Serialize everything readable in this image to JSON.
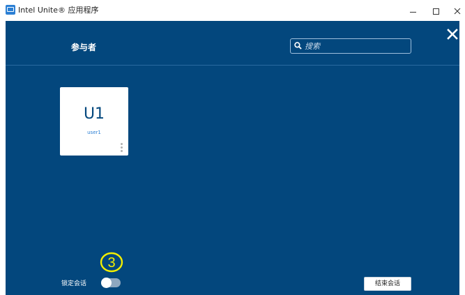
{
  "window": {
    "title": "Intel Unite® 应用程序"
  },
  "header": {
    "title": "参与者"
  },
  "search": {
    "placeholder": "搜索",
    "value": ""
  },
  "participants": [
    {
      "initials": "U1",
      "name": "user1"
    }
  ],
  "footer": {
    "lock_label": "锁定会话",
    "lock_enabled": false,
    "end_button_label": "结束会话"
  },
  "annotation": {
    "step_number": "3"
  },
  "colors": {
    "panel_background": "#03477d",
    "accent": "#2b7fd4",
    "badge": "#f2ee00"
  },
  "icons": [
    "app-icon",
    "minimize-icon",
    "maximize-icon",
    "close-icon",
    "search-icon",
    "more-vertical-icon"
  ]
}
